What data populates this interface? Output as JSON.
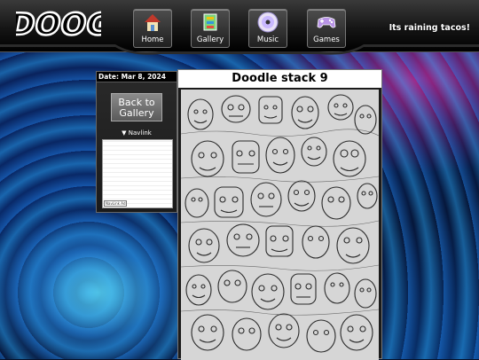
{
  "header": {
    "logo_text": "DOOG",
    "tagline": "Its raining tacos!",
    "nav": [
      {
        "label": "Home",
        "icon": "house-icon"
      },
      {
        "label": "Gallery",
        "icon": "paintbrush-icon"
      },
      {
        "label": "Music",
        "icon": "cd-icon"
      },
      {
        "label": "Games",
        "icon": "gamepad-icon"
      }
    ]
  },
  "sidebar": {
    "date": "Date: Mar 8, 2024",
    "back_label": "Back to Gallery",
    "navlink": "▼ Navlink",
    "ad_tag": "NavLink Ad"
  },
  "main": {
    "title": "Doodle stack 9",
    "image_alt": "pencil doodle sketch page"
  },
  "colors": {
    "accent_pink": "#d0289a",
    "accent_blue": "#2a8ae0"
  }
}
